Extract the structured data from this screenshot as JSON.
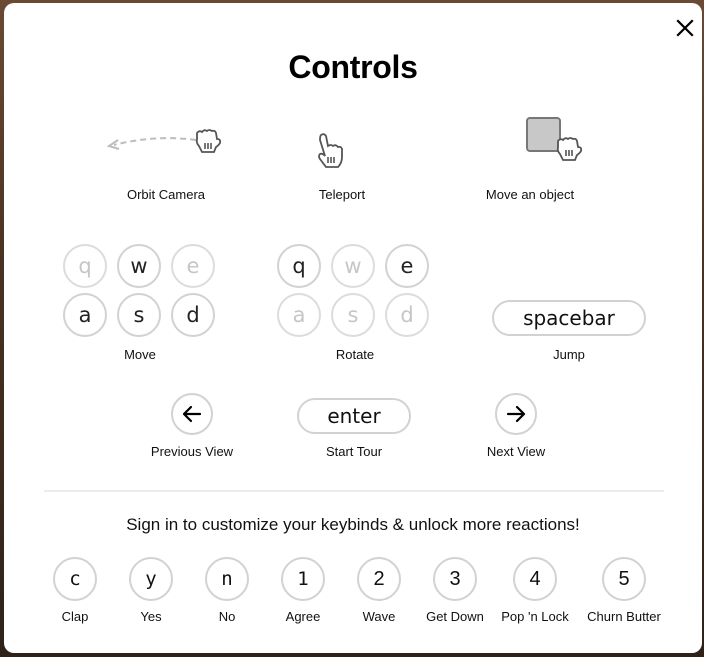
{
  "modal": {
    "title": "Controls",
    "close_icon": "close-icon"
  },
  "mouse_controls": [
    {
      "label": "Orbit Camera",
      "icon": "orbit-drag-hand-icon"
    },
    {
      "label": "Teleport",
      "icon": "pointing-hand-icon"
    },
    {
      "label": "Move an object",
      "icon": "grab-object-icon"
    }
  ],
  "move": {
    "label": "Move",
    "keys": [
      {
        "key": "q",
        "active": false
      },
      {
        "key": "w",
        "active": true
      },
      {
        "key": "e",
        "active": false
      },
      {
        "key": "a",
        "active": true
      },
      {
        "key": "s",
        "active": true
      },
      {
        "key": "d",
        "active": true
      }
    ]
  },
  "rotate": {
    "label": "Rotate",
    "keys": [
      {
        "key": "q",
        "active": true
      },
      {
        "key": "w",
        "active": false
      },
      {
        "key": "e",
        "active": true
      },
      {
        "key": "a",
        "active": false
      },
      {
        "key": "s",
        "active": false
      },
      {
        "key": "d",
        "active": false
      }
    ]
  },
  "jump": {
    "key": "spacebar",
    "label": "Jump"
  },
  "navigation": {
    "previous": {
      "icon": "arrow-left-icon",
      "label": "Previous View"
    },
    "start_tour": {
      "key": "enter",
      "label": "Start Tour"
    },
    "next": {
      "icon": "arrow-right-icon",
      "label": "Next View"
    }
  },
  "signin_text": "Sign in to customize your keybinds & unlock more reactions!",
  "reactions": [
    {
      "key": "c",
      "label": "Clap"
    },
    {
      "key": "y",
      "label": "Yes"
    },
    {
      "key": "n",
      "label": "No"
    },
    {
      "key": "1",
      "label": "Agree"
    },
    {
      "key": "2",
      "label": "Wave"
    },
    {
      "key": "3",
      "label": "Get Down"
    },
    {
      "key": "4",
      "label": "Pop 'n Lock"
    },
    {
      "key": "5",
      "label": "Churn Butter"
    }
  ],
  "colors": {
    "key_border": "#d2d2d2",
    "key_dim_text": "#c6c6c6",
    "text": "#111111"
  }
}
